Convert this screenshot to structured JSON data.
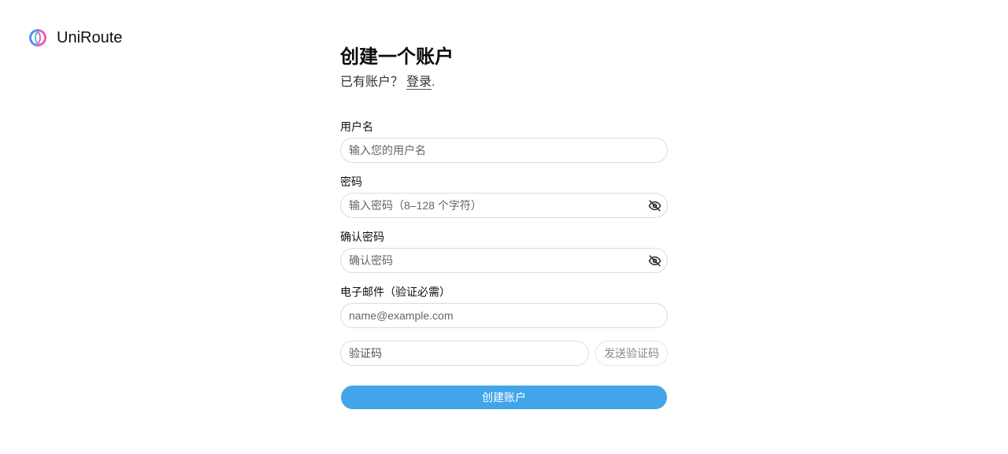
{
  "brand": {
    "name": "UniRoute",
    "logo_icon": "uniroute-logo-icon",
    "logo_colors": [
      "#5b8def",
      "#ec5fb8",
      "#3cc9d9"
    ]
  },
  "form": {
    "title": "创建一个账户",
    "have_account_text": "已有账户？",
    "login_link": "登录",
    "login_suffix": ".",
    "username": {
      "label": "用户名",
      "placeholder": "输入您的用户名"
    },
    "password": {
      "label": "密码",
      "placeholder": "输入密码（8–128 个字符）",
      "toggle_icon": "eye-off-icon"
    },
    "confirm_password": {
      "label": "确认密码",
      "placeholder": "确认密码",
      "toggle_icon": "eye-off-icon"
    },
    "email": {
      "label": "电子邮件（验证必需）",
      "placeholder": "name@example.com"
    },
    "verification": {
      "placeholder": "验证码",
      "send_button": "发送验证码"
    },
    "submit_button": "创建账户"
  },
  "colors": {
    "primary": "#42a5ea",
    "border": "#dcdcdc",
    "text": "#111111"
  }
}
